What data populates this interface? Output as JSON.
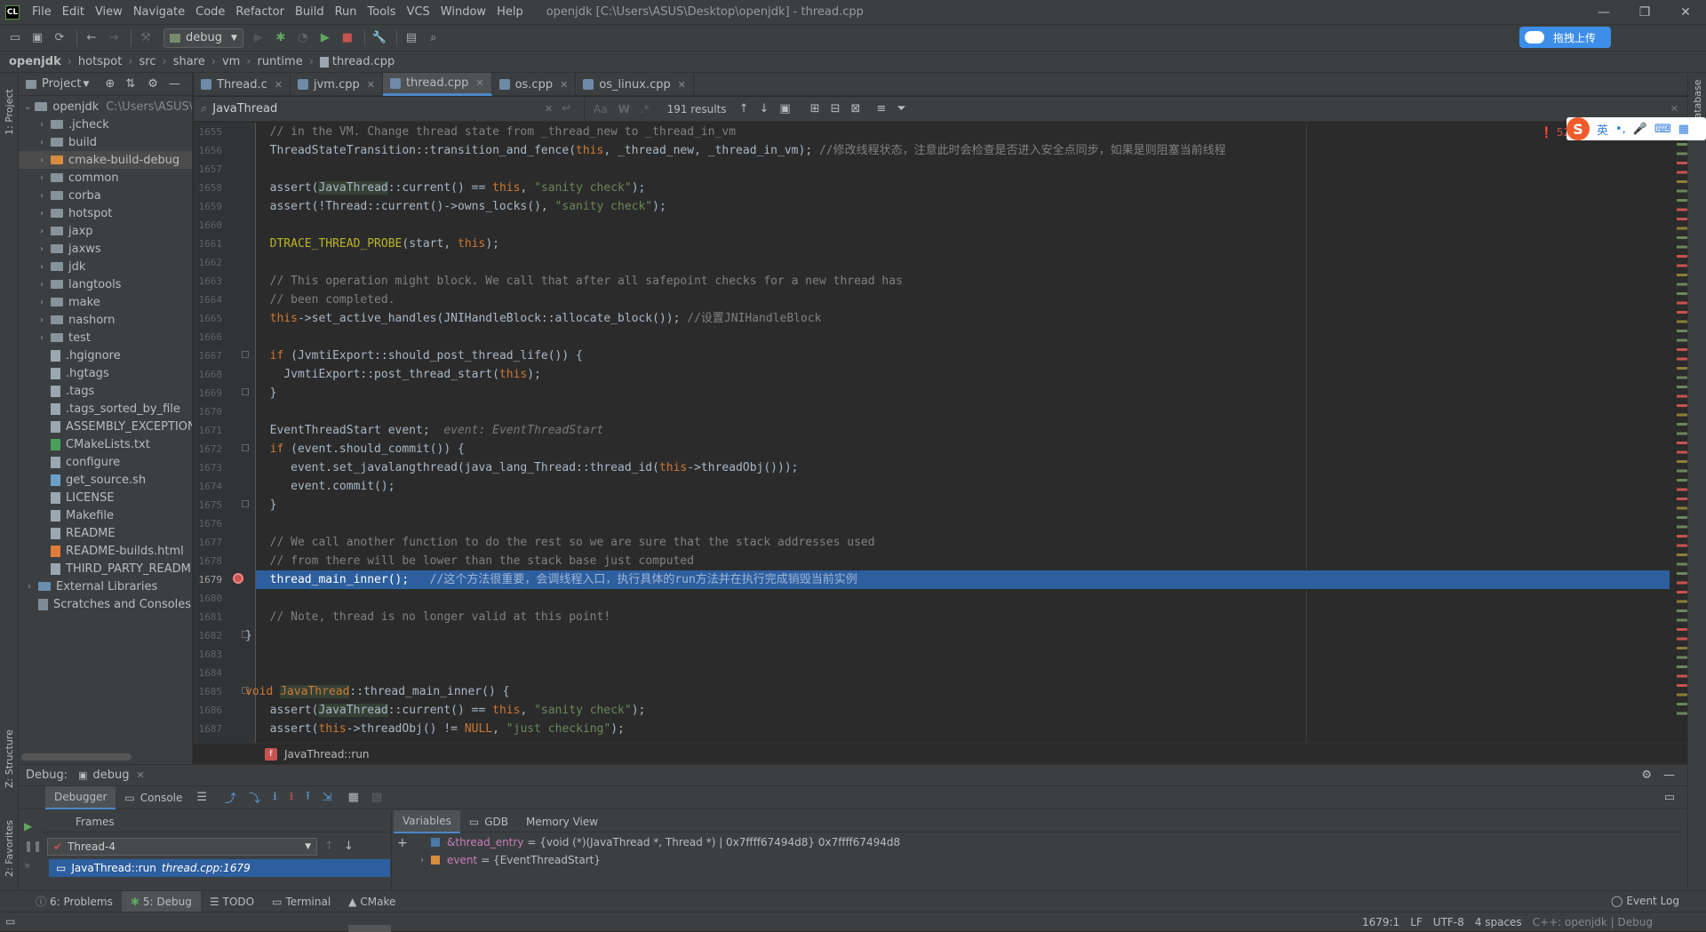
{
  "window": {
    "title": "openjdk [C:\\Users\\ASUS\\Desktop\\openjdk] - thread.cpp",
    "logo": "CL"
  },
  "menu": [
    "File",
    "Edit",
    "View",
    "Navigate",
    "Code",
    "Refactor",
    "Build",
    "Run",
    "Tools",
    "VCS",
    "Window",
    "Help"
  ],
  "toolbar": {
    "run_config": "debug"
  },
  "upload_button": "拖拽上传",
  "breadcrumb": [
    "openjdk",
    "hotspot",
    "src",
    "share",
    "vm",
    "runtime",
    "thread.cpp"
  ],
  "left_strip": {
    "project": "1: Project",
    "structure": "Z: Structure",
    "favorites": "2: Favorites"
  },
  "right_strip": {
    "database": "Database"
  },
  "project_panel": {
    "title": "Project",
    "root": {
      "name": "openjdk",
      "path": "C:\\Users\\ASUS\\"
    },
    "folders": [
      ".jcheck",
      "build",
      "cmake-build-debug",
      "common",
      "corba",
      "hotspot",
      "jaxp",
      "jaxws",
      "jdk",
      "langtools",
      "make",
      "nashorn",
      "test"
    ],
    "selected_folder": "cmake-build-debug",
    "files": [
      ".hgignore",
      ".hgtags",
      ".tags",
      ".tags_sorted_by_file",
      "ASSEMBLY_EXCEPTION",
      "CMakeLists.txt",
      "configure",
      "get_source.sh",
      "LICENSE",
      "Makefile",
      "README",
      "README-builds.html",
      "THIRD_PARTY_README"
    ],
    "external": "External Libraries",
    "scratches": "Scratches and Consoles"
  },
  "tabs": [
    {
      "label": "Thread.c",
      "active": false
    },
    {
      "label": "jvm.cpp",
      "active": false
    },
    {
      "label": "thread.cpp",
      "active": true
    },
    {
      "label": "os.cpp",
      "active": false
    },
    {
      "label": "os_linux.cpp",
      "active": false
    }
  ],
  "search": {
    "query": "JavaThread",
    "results": "191 results",
    "match_case": "Aa",
    "words": "W",
    "regex": ".*"
  },
  "problems_count": "52",
  "ime": {
    "logo": "S",
    "lang": "英"
  },
  "editor": {
    "line_numbers": [
      "1655",
      "1656",
      "1657",
      "1658",
      "1659",
      "1660",
      "1661",
      "1662",
      "1663",
      "1664",
      "1665",
      "1666",
      "1667",
      "1668",
      "1669",
      "1670",
      "1671",
      "1672",
      "1673",
      "1674",
      "1675",
      "1676",
      "1677",
      "1678",
      "1679",
      "1680",
      "1681",
      "1682",
      "1683",
      "1684",
      "1685",
      "1686",
      "1687"
    ],
    "highlighted_line": "1679",
    "lines": {
      "l1655": "  // in the VM. Change thread state from _thread_new to _thread_in_vm",
      "l1656a": "  ThreadStateTransition::transition_and_fence(",
      "l1656b": "this",
      "l1656c": ", _thread_new, _thread_in_vm); ",
      "l1656d": "//修改线程状态，注意此时会检查是否进入安全点同步，如果是则阻塞当前线程",
      "l1658a": "  assert(",
      "l1658b": "JavaThread",
      "l1658c": "::current() == ",
      "l1658d": "this",
      "l1658e": ", ",
      "l1658f": "\"sanity check\"",
      "l1658g": ");",
      "l1659a": "  assert(!Thread::current()->owns_locks(), ",
      "l1659b": "\"sanity check\"",
      "l1659c": ");",
      "l1661a": "  DTRACE_THREAD_PROBE",
      "l1661b": "(start, ",
      "l1661c": "this",
      "l1661d": ");",
      "l1663": "  // This operation might block. We call that after all safepoint checks for a new thread has",
      "l1664": "  // been completed.",
      "l1665a": "  this",
      "l1665b": "->set_active_handles(JNIHandleBlock::allocate_block()); ",
      "l1665c": "//设置JNIHandleBlock",
      "l1667a": "  if",
      "l1667b": " (JvmtiExport::should_post_thread_life()) {",
      "l1668a": "    JvmtiExport::post_thread_start(",
      "l1668b": "this",
      "l1668c": ");",
      "l1669": "  }",
      "l1671a": "  EventThreadStart event;  ",
      "l1671b": "event: EventThreadStart",
      "l1672a": "  if",
      "l1672b": " (event.should_commit()) {",
      "l1673a": "     event.set_javalangthread(java_lang_Thread::thread_id(",
      "l1673b": "this",
      "l1673c": "->threadObj()));",
      "l1674": "     event.commit();",
      "l1675": "  }",
      "l1677": "  // We call another function to do the rest so we are sure that the stack addresses used",
      "l1678": "  // from there will be lower than the stack base just computed",
      "l1679a": "  thread_main_inner();   ",
      "l1679b": "//这个方法很重要，会调线程入口，执行具体的run方法并在执行完成销毁当前实例",
      "l1681": "  // Note, thread is no longer valid at this point!",
      "l1682": "}",
      "l1685a": "void ",
      "l1685b": "JavaThread",
      "l1685c": "::thread_main_inner() {",
      "l1686a": "  assert(",
      "l1686b": "JavaThread",
      "l1686c": "::current() == ",
      "l1686d": "this",
      "l1686e": ", ",
      "l1686f": "\"sanity check\"",
      "l1686g": ");",
      "l1687a": "  assert(",
      "l1687b": "this",
      "l1687c": "->threadObj() != ",
      "l1687d": "NULL",
      "l1687e": ", ",
      "l1687f": "\"just checking\"",
      "l1687g": ");"
    },
    "function_crumb": "JavaThread::run"
  },
  "debug": {
    "label": "Debug:",
    "session": "debug",
    "tabs": [
      "Debugger",
      "Console"
    ],
    "frames_label": "Frames",
    "thread": "Thread-4",
    "frame": {
      "func": "JavaThread::run",
      "loc": "thread.cpp:1679"
    },
    "var_tabs": [
      "Variables",
      "GDB",
      "Memory View"
    ],
    "variables": [
      {
        "name": "&thread_entry",
        "value": "= {void (*)(JavaThread *, Thread *) | 0x7ffff67494d8} 0x7ffff67494d8"
      },
      {
        "name": "event",
        "value": "= {EventThreadStart}"
      }
    ]
  },
  "bottom_tabs": [
    "6: Problems",
    "5: Debug",
    "TODO",
    "Terminal",
    "CMake"
  ],
  "event_log": "Event Log",
  "status": {
    "position": "1679:1",
    "line_sep": "LF",
    "encoding": "UTF-8",
    "indent": "4 spaces",
    "context": "C++: openjdk | Debug"
  }
}
